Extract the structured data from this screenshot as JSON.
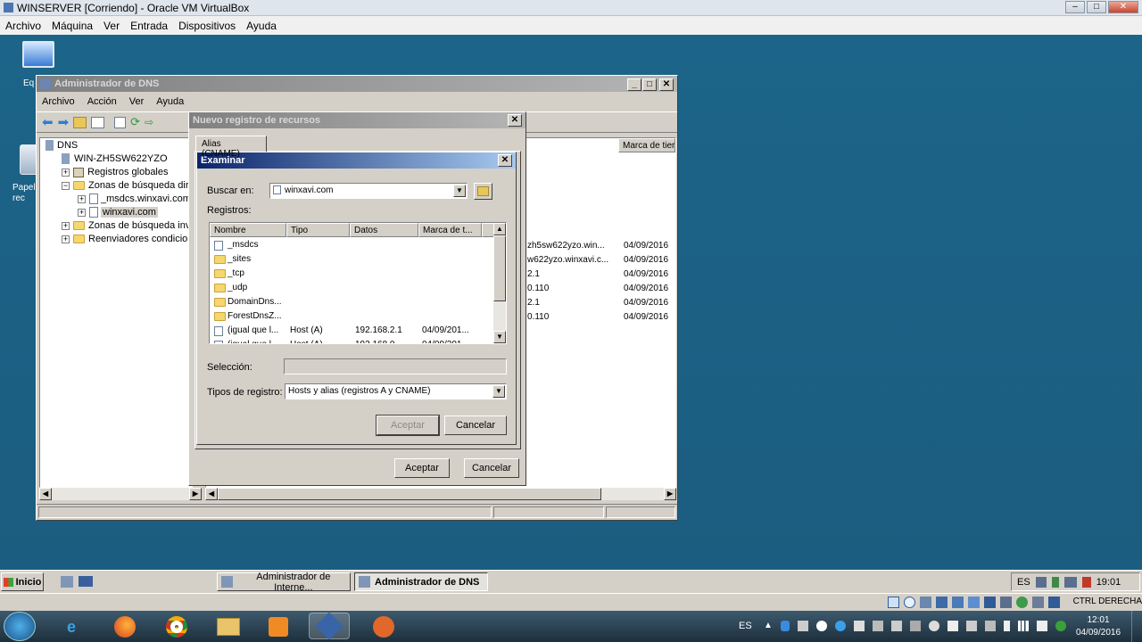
{
  "vbox": {
    "title": "WINSERVER [Corriendo] - Oracle VM VirtualBox",
    "menu": [
      "Archivo",
      "Máquina",
      "Ver",
      "Entrada",
      "Dispositivos",
      "Ayuda"
    ]
  },
  "desktop": {
    "icons": [
      "Eq",
      "Papel\nrec"
    ]
  },
  "dns_window": {
    "title": "Administrador de DNS",
    "menu": [
      "Archivo",
      "Acción",
      "Ver",
      "Ayuda"
    ],
    "tree": [
      "DNS",
      "WIN-ZH5SW622YZO",
      "Registros globales",
      "Zonas de búsqueda dire",
      "_msdcs.winxavi.com",
      "winxavi.com",
      "Zonas de búsqueda inve",
      "Reenviadores condicion"
    ],
    "right_header": "Marca de tier",
    "right_rows": [
      {
        "data": "zh5sw622yzo.win...",
        "date": "04/09/2016"
      },
      {
        "data": "w622yzo.winxavi.c...",
        "date": "04/09/2016"
      },
      {
        "data": "2.1",
        "date": "04/09/2016"
      },
      {
        "data": "0.110",
        "date": "04/09/2016"
      },
      {
        "data": "2.1",
        "date": "04/09/2016"
      },
      {
        "data": "0.110",
        "date": "04/09/2016"
      }
    ]
  },
  "new_record": {
    "title": "Nuevo registro de recursos",
    "tab": "Alias (CNAME)",
    "ok": "Aceptar",
    "cancel": "Cancelar"
  },
  "browse": {
    "title": "Examinar",
    "lookin_label": "Buscar en:",
    "lookin_value": "winxavi.com",
    "records_label": "Registros:",
    "columns": [
      "Nombre",
      "Tipo",
      "Datos",
      "Marca de t..."
    ],
    "items": [
      {
        "name": "_msdcs",
        "type": "",
        "data": "",
        "stamp": "",
        "icon": "zone-icon"
      },
      {
        "name": "_sites",
        "type": "",
        "data": "",
        "stamp": "",
        "icon": "folder-icon"
      },
      {
        "name": "_tcp",
        "type": "",
        "data": "",
        "stamp": "",
        "icon": "folder-icon"
      },
      {
        "name": "_udp",
        "type": "",
        "data": "",
        "stamp": "",
        "icon": "folder-icon"
      },
      {
        "name": "DomainDns...",
        "type": "",
        "data": "",
        "stamp": "",
        "icon": "folder-icon"
      },
      {
        "name": "ForestDnsZ...",
        "type": "",
        "data": "",
        "stamp": "",
        "icon": "folder-icon"
      },
      {
        "name": "(igual que l...",
        "type": "Host (A)",
        "data": "192.168.2.1",
        "stamp": "04/09/201...",
        "icon": "record-icon"
      },
      {
        "name": "(igual que l...",
        "type": "Host (A)",
        "data": "192.168.0...",
        "stamp": "04/09/201...",
        "icon": "record-icon"
      }
    ],
    "selection_label": "Selección:",
    "selection_value": "",
    "types_label": "Tipos de registro:",
    "types_value": "Hosts y alias (registros A y CNAME)",
    "ok": "Aceptar",
    "cancel": "Cancelar"
  },
  "taskbar": {
    "start": "Inicio",
    "tasks": [
      "Administrador de Interne...",
      "Administrador de DNS"
    ],
    "lang": "ES",
    "clock": "19:01"
  },
  "host_tray": {
    "label": "CTRL DERECHA"
  },
  "win7": {
    "lang": "ES",
    "time": "12:01",
    "date": "04/09/2016"
  }
}
